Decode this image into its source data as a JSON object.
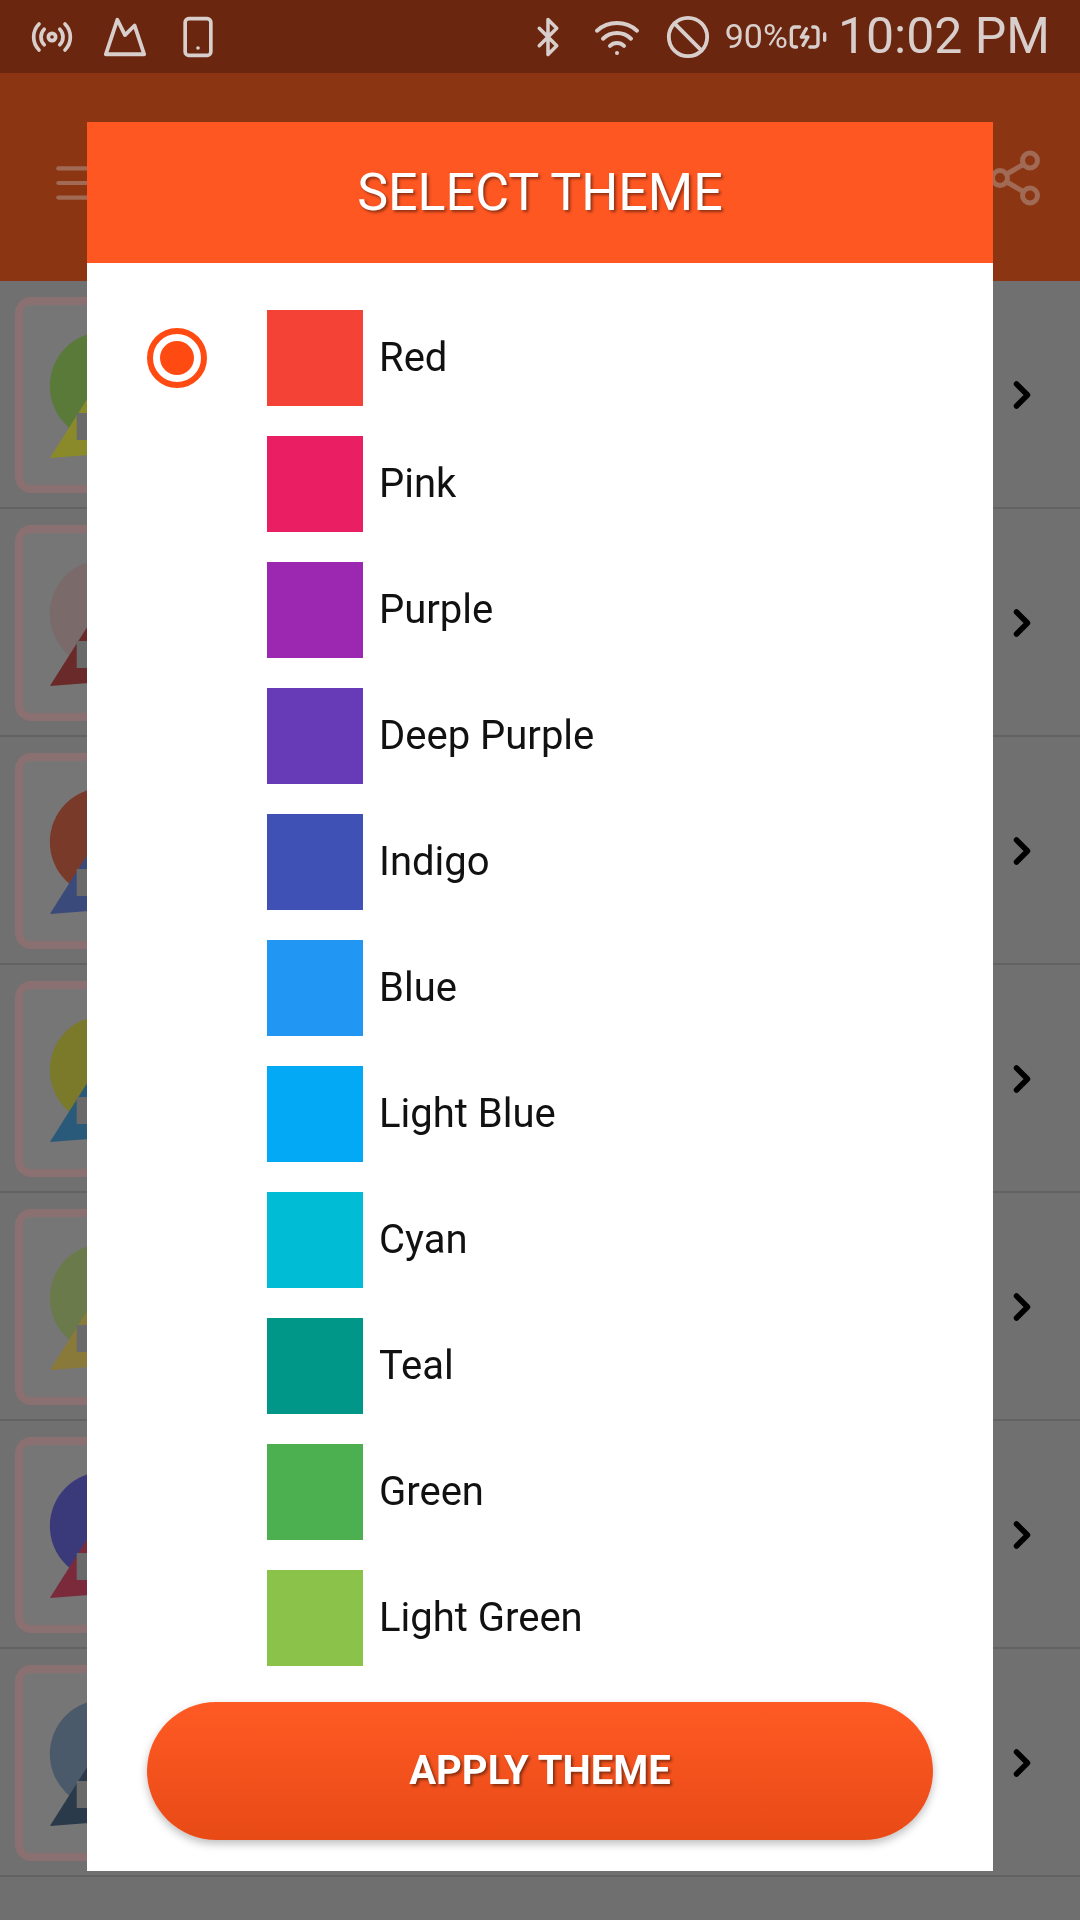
{
  "status_bar": {
    "battery": "90%",
    "time": "10:02 PM"
  },
  "dialog": {
    "title": "SELECT THEME",
    "themes": [
      {
        "label": "Red",
        "color": "#f44336",
        "selected": true
      },
      {
        "label": "Pink",
        "color": "#e91e63",
        "selected": false
      },
      {
        "label": "Purple",
        "color": "#9c27b0",
        "selected": false
      },
      {
        "label": "Deep Purple",
        "color": "#673ab7",
        "selected": false
      },
      {
        "label": "Indigo",
        "color": "#3f51b5",
        "selected": false
      },
      {
        "label": "Blue",
        "color": "#2196f3",
        "selected": false
      },
      {
        "label": "Light Blue",
        "color": "#03a9f4",
        "selected": false
      },
      {
        "label": "Cyan",
        "color": "#00bcd4",
        "selected": false
      },
      {
        "label": "Teal",
        "color": "#009688",
        "selected": false
      },
      {
        "label": "Green",
        "color": "#4caf50",
        "selected": false
      },
      {
        "label": "Light Green",
        "color": "#8bc34a",
        "selected": false
      }
    ],
    "apply_button": "APPLY THEME"
  }
}
